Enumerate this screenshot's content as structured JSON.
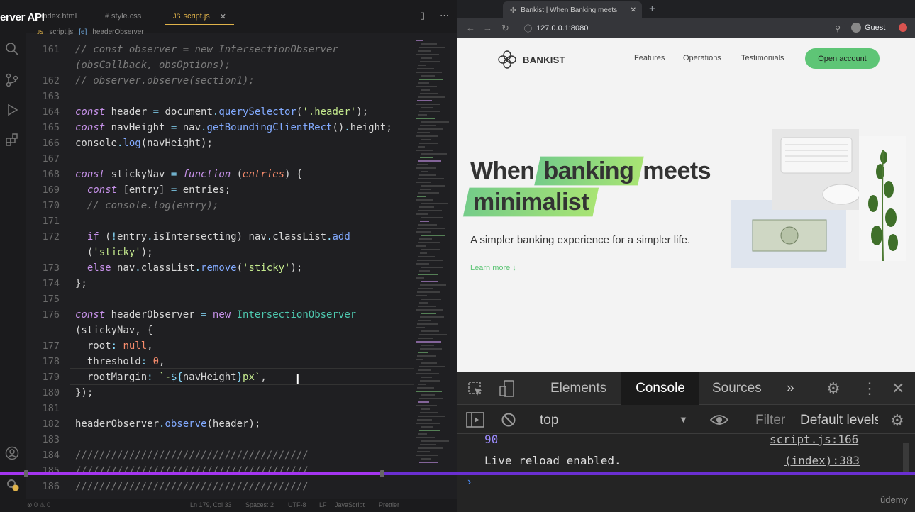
{
  "overlay_title": "erver API",
  "editor": {
    "tabs": [
      {
        "label": "index.html",
        "icon": "html-icon"
      },
      {
        "label": "style.css",
        "icon": "css-icon"
      },
      {
        "label": "script.js",
        "icon": "js-icon",
        "active": true
      }
    ],
    "breadcrumb": {
      "file": "script.js",
      "file_icon": "JS",
      "symbol": "headerObserver"
    },
    "line_numbers": [
      "161",
      "162",
      "163",
      "164",
      "165",
      "166",
      "167",
      "168",
      "169",
      "170",
      "171",
      "172",
      "173",
      "174",
      "175",
      "176",
      "177",
      "178",
      "179",
      "180",
      "181",
      "182",
      "183",
      "184",
      "185",
      "186"
    ],
    "status": {
      "left": "⊗ 0 ⚠ 0",
      "position": "Ln 179, Col 33",
      "spaces": "Spaces: 2",
      "encoding": "UTF-8",
      "eol": "LF",
      "language": "JavaScript",
      "formatter": "Prettier"
    }
  },
  "progress": {
    "value": 0.42
  },
  "browser": {
    "tab_title": "Bankist | When Banking meets",
    "url": "127.0.0.1:8080",
    "profile": "Guest"
  },
  "page": {
    "logo": "BANKIST",
    "nav": [
      "Features",
      "Operations",
      "Testimonials"
    ],
    "cta": "Open account",
    "hero_w1": "When",
    "hero_w2": "banking",
    "hero_w3": "meets",
    "hero_w4": "minimalist",
    "subtitle": "A simpler banking experience for a simpler life.",
    "learn_more": "Learn more ↓"
  },
  "devtools": {
    "tabs": [
      "Elements",
      "Console",
      "Sources"
    ],
    "active_tab": "Console",
    "context": "top",
    "filter_placeholder": "Filter",
    "levels": "Default levels",
    "messages": [
      {
        "text": "90",
        "source": "script.js:166"
      },
      {
        "text": "Live reload enabled.",
        "source": "(index):383"
      }
    ]
  },
  "watermark": "ûdemy",
  "colors": {
    "accent_green": "#5ec576",
    "progress": "#a435f0"
  }
}
